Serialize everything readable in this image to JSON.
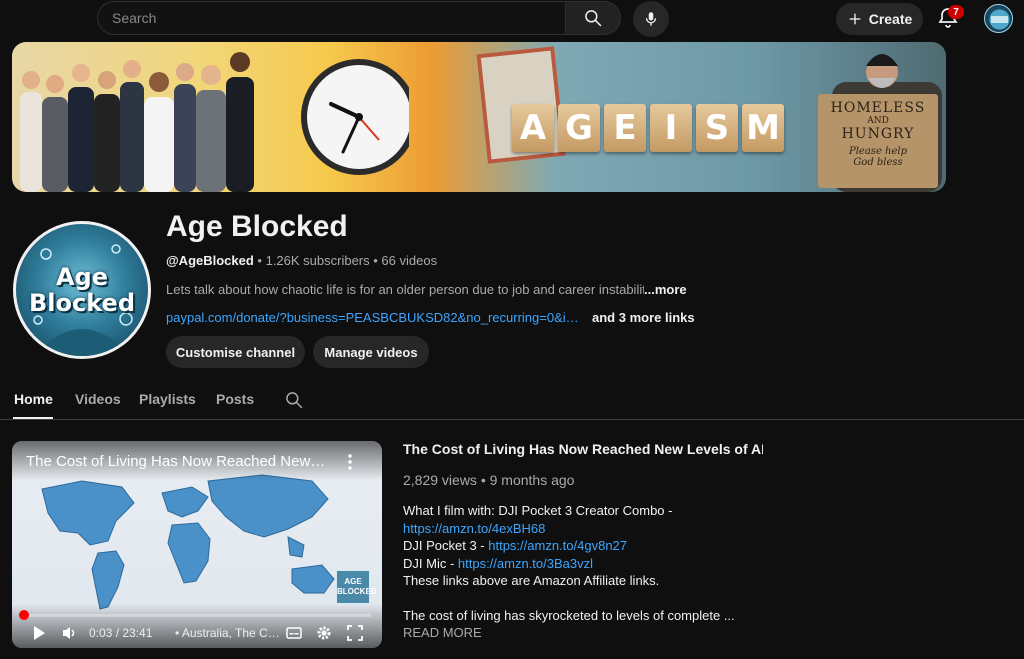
{
  "topbar": {
    "search_placeholder": "Search",
    "create_label": "Create",
    "notification_count": "7"
  },
  "banner": {
    "blocks": [
      "A",
      "G",
      "E",
      "I",
      "S",
      "M"
    ],
    "sign": {
      "line1": "HOMELESS",
      "line2": "AND",
      "line3": "HUNGRY",
      "line4": "Please help",
      "line5": "God bless"
    }
  },
  "channel": {
    "avatar_line1": "Age",
    "avatar_line2": "Blocked",
    "name": "Age Blocked",
    "handle": "@AgeBlocked",
    "stats": " • 1.26K subscribers • 66 videos",
    "description": "Lets talk about how chaotic life is for an older person due to job and career instability",
    "more_label": "...more",
    "link": "paypal.com/donate/?business=PEASBCBUKSD82&no_recurring=0&ite...",
    "more_links": "and 3 more links",
    "customise_label": "Customise channel",
    "manage_label": "Manage videos"
  },
  "tabs": [
    {
      "label": "Home",
      "active": true
    },
    {
      "label": "Videos"
    },
    {
      "label": "Playlists"
    },
    {
      "label": "Posts"
    }
  ],
  "player": {
    "title": "The Cost of Living Has Now Reached New Levels of ABSURDITY",
    "mini_logo": "AGE BLOCKED",
    "time": "0:03 / 23:41",
    "chapter": "• Australia, The Cost of Living",
    "progress_fraction": 0.002
  },
  "video": {
    "title": "The Cost of Living Has Now Reached New Levels of ABSU...",
    "meta": "2,829 views • 9 months ago",
    "desc": {
      "line1": "What I film with: DJI Pocket 3 Creator Combo  -",
      "link1": "https://amzn.to/4exBH68",
      "line2_prefix": "DJI Pocket 3 -  ",
      "link2": "https://amzn.to/4gv8n27",
      "line3_prefix": "DJI Mic - ",
      "link3": "https://amzn.to/3Ba3vzl",
      "line4": "These links above are Amazon Affiliate links.",
      "line5": "The cost of living has skyrocketed to levels of complete ..."
    },
    "read_more": "READ MORE"
  },
  "colors": {
    "background": "#0f0f0f",
    "link": "#3ea6ff",
    "badge": "#cc0000",
    "progress": "#ff0000"
  }
}
